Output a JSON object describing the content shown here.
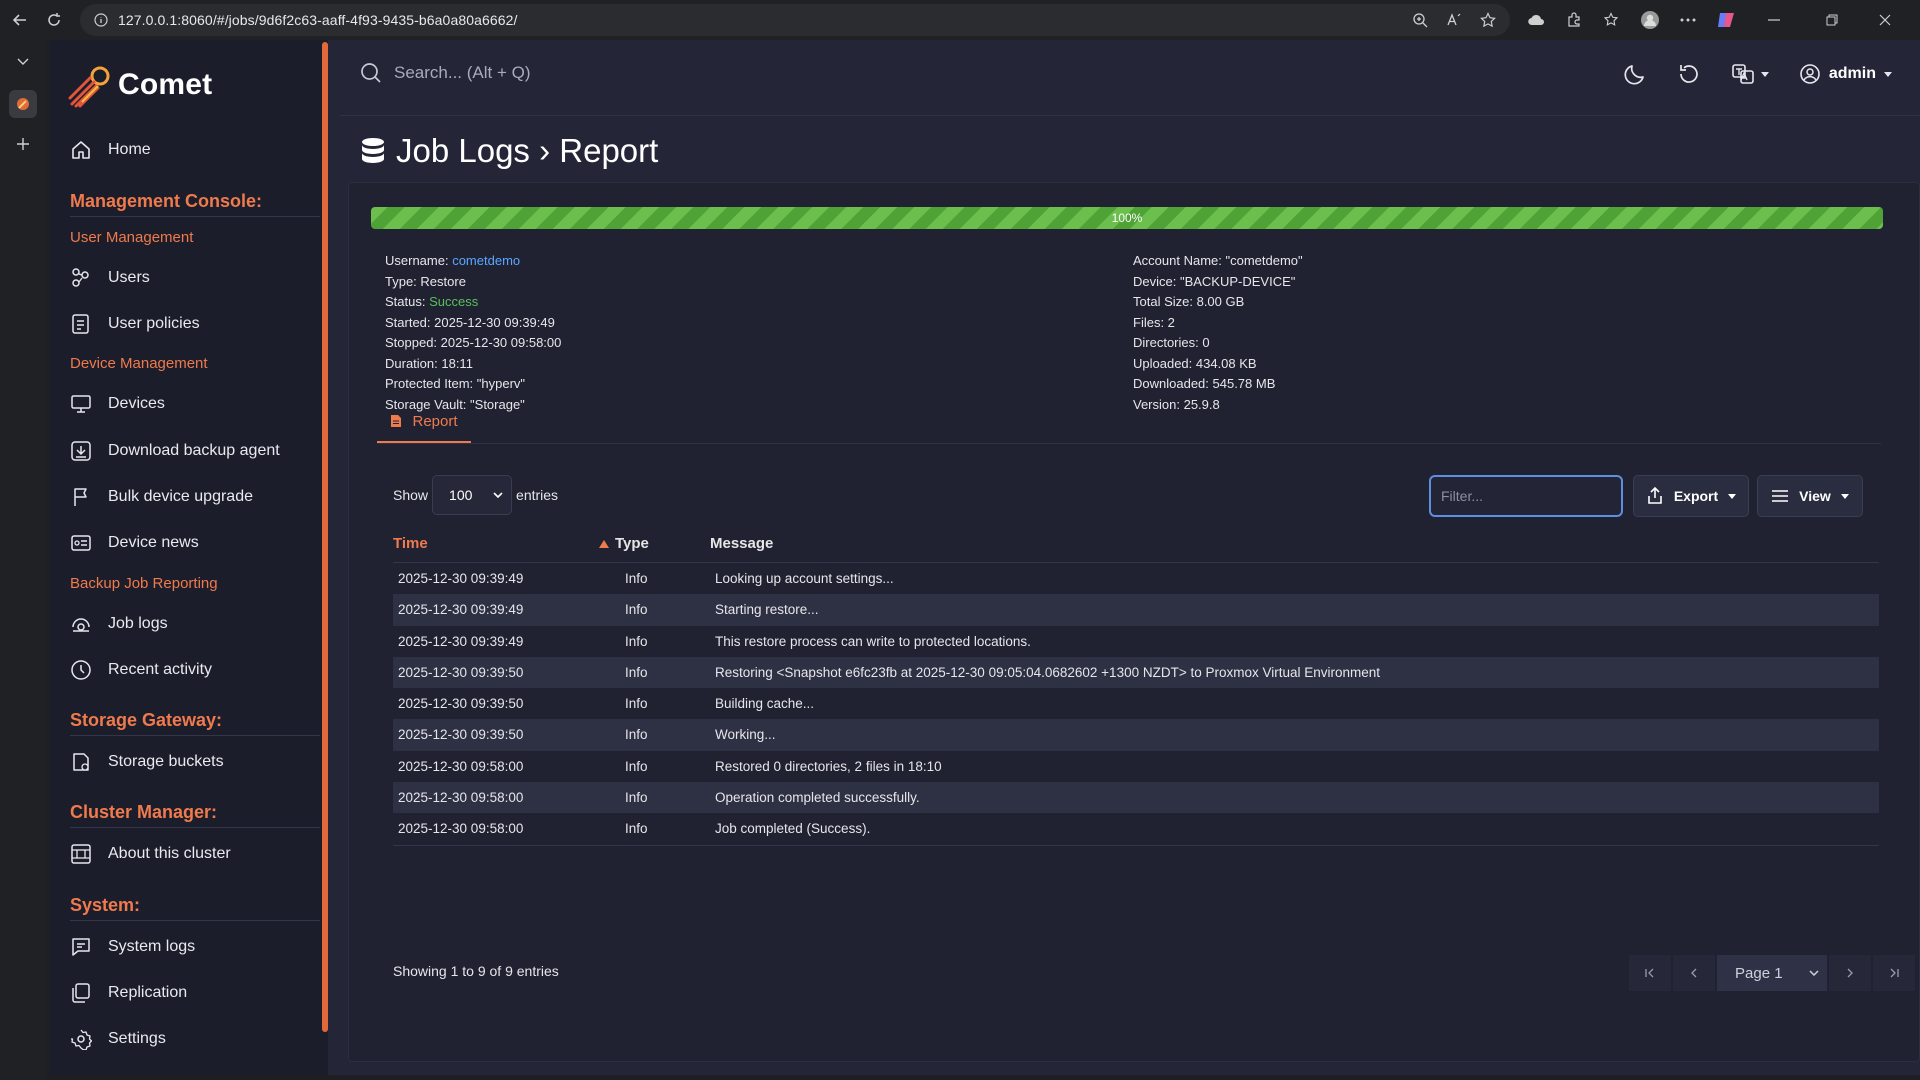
{
  "browser": {
    "url": "127.0.0.1:8060/#/jobs/9d6f2c63-aaff-4f93-9435-b6a0a80a6662/"
  },
  "app": {
    "logo_text": "Comet",
    "search_placeholder": "Search... (Alt + Q)",
    "user": "admin"
  },
  "sidebar": {
    "home": "Home",
    "management_console": "Management Console:",
    "user_management": "User Management",
    "users": "Users",
    "user_policies": "User policies",
    "device_management": "Device Management",
    "devices": "Devices",
    "download_backup_agent": "Download backup agent",
    "bulk_device_upgrade": "Bulk device upgrade",
    "device_news": "Device news",
    "backup_job_reporting": "Backup Job Reporting",
    "job_logs": "Job logs",
    "recent_activity": "Recent activity",
    "storage_gateway": "Storage Gateway:",
    "storage_buckets": "Storage buckets",
    "cluster_manager": "Cluster Manager:",
    "about_cluster": "About this cluster",
    "system": "System:",
    "system_logs": "System logs",
    "replication": "Replication",
    "settings": "Settings"
  },
  "page": {
    "title": "Job Logs › Report",
    "progress": {
      "value": 1.0,
      "label": "100%"
    }
  },
  "job_info_left": {
    "username_label": "Username: ",
    "username": "cometdemo",
    "type": "Type: Restore",
    "status_label": "Status: ",
    "status": "Success",
    "started": "Started: 2025-12-30 09:39:49",
    "stopped": "Stopped: 2025-12-30 09:58:00",
    "duration": "Duration: 18:11",
    "protected_item": "Protected Item: \"hyperv\"",
    "storage_vault": "Storage Vault: \"Storage\""
  },
  "job_info_right": {
    "account_name": "Account Name: \"cometdemo\"",
    "device": "Device: \"BACKUP-DEVICE\"",
    "total_size": "Total Size: 8.00 GB",
    "files": "Files: 2",
    "directories": "Directories: 0",
    "uploaded": "Uploaded: 434.08 KB",
    "downloaded": "Downloaded: 545.78 MB",
    "version": "Version: 25.9.8"
  },
  "tabs": {
    "report": "Report"
  },
  "table_controls": {
    "show": "Show",
    "entries_value": "100",
    "entries": "entries",
    "filter_placeholder": "Filter...",
    "export": "Export",
    "view": "View"
  },
  "table": {
    "headers": {
      "time": "Time",
      "type": "Type",
      "message": "Message"
    },
    "rows": [
      {
        "time": "2025-12-30 09:39:49",
        "type": "Info",
        "message": "Looking up account settings..."
      },
      {
        "time": "2025-12-30 09:39:49",
        "type": "Info",
        "message": "Starting restore..."
      },
      {
        "time": "2025-12-30 09:39:49",
        "type": "Info",
        "message": "This restore process can write to protected locations."
      },
      {
        "time": "2025-12-30 09:39:50",
        "type": "Info",
        "message": "Restoring <Snapshot e6fc23fb at 2025-12-30 09:05:04.0682602 +1300 NZDT> to Proxmox Virtual Environment"
      },
      {
        "time": "2025-12-30 09:39:50",
        "type": "Info",
        "message": "Building cache..."
      },
      {
        "time": "2025-12-30 09:39:50",
        "type": "Info",
        "message": "Working..."
      },
      {
        "time": "2025-12-30 09:58:00",
        "type": "Info",
        "message": "Restored 0 directories, 2 files in 18:10"
      },
      {
        "time": "2025-12-30 09:58:00",
        "type": "Info",
        "message": "Operation completed successfully."
      },
      {
        "time": "2025-12-30 09:58:00",
        "type": "Info",
        "message": "Job completed (Success)."
      }
    ]
  },
  "footer": {
    "showing": "Showing 1 to 9 of 9 entries",
    "page": "Page 1"
  }
}
